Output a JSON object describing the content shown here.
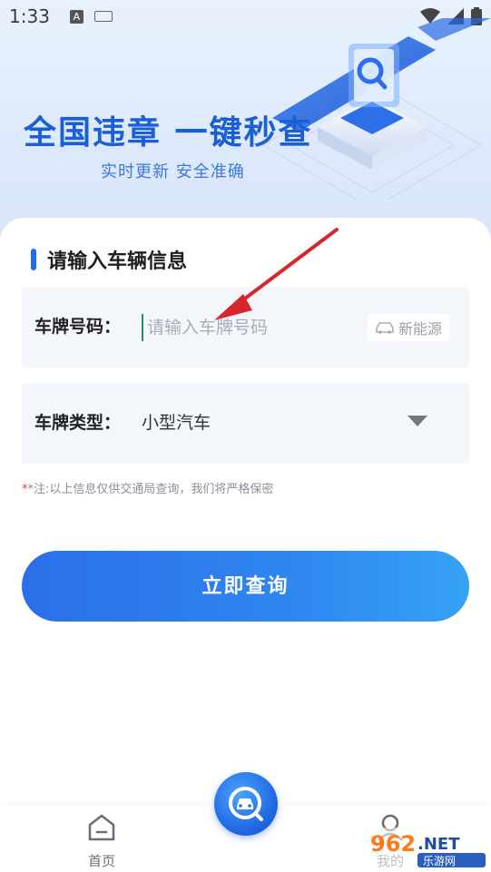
{
  "status_bar": {
    "time": "1:33",
    "input_badge": "A"
  },
  "hero": {
    "title": "全国违章 一键秒查",
    "subtitle": "实时更新 安全准确"
  },
  "form": {
    "section_title": "请输入车辆信息",
    "plate_label": "车牌号码：",
    "plate_placeholder": "请输入车牌号码",
    "plate_value": "",
    "new_energy_label": "新能源",
    "type_label": "车牌类型：",
    "type_value": "小型汽车",
    "note_star": "*",
    "note": "*注:以上信息仅供交通局查询，我们将严格保密",
    "submit_label": "立即查询"
  },
  "tabbar": {
    "home_label": "首页",
    "mine_label": "我的"
  },
  "watermark": {
    "text": "962.NET 乐游网"
  },
  "colors": {
    "accent": "#1f6ee8",
    "title_blue": "#1a5fd6",
    "annotation_red": "#d9262c"
  }
}
